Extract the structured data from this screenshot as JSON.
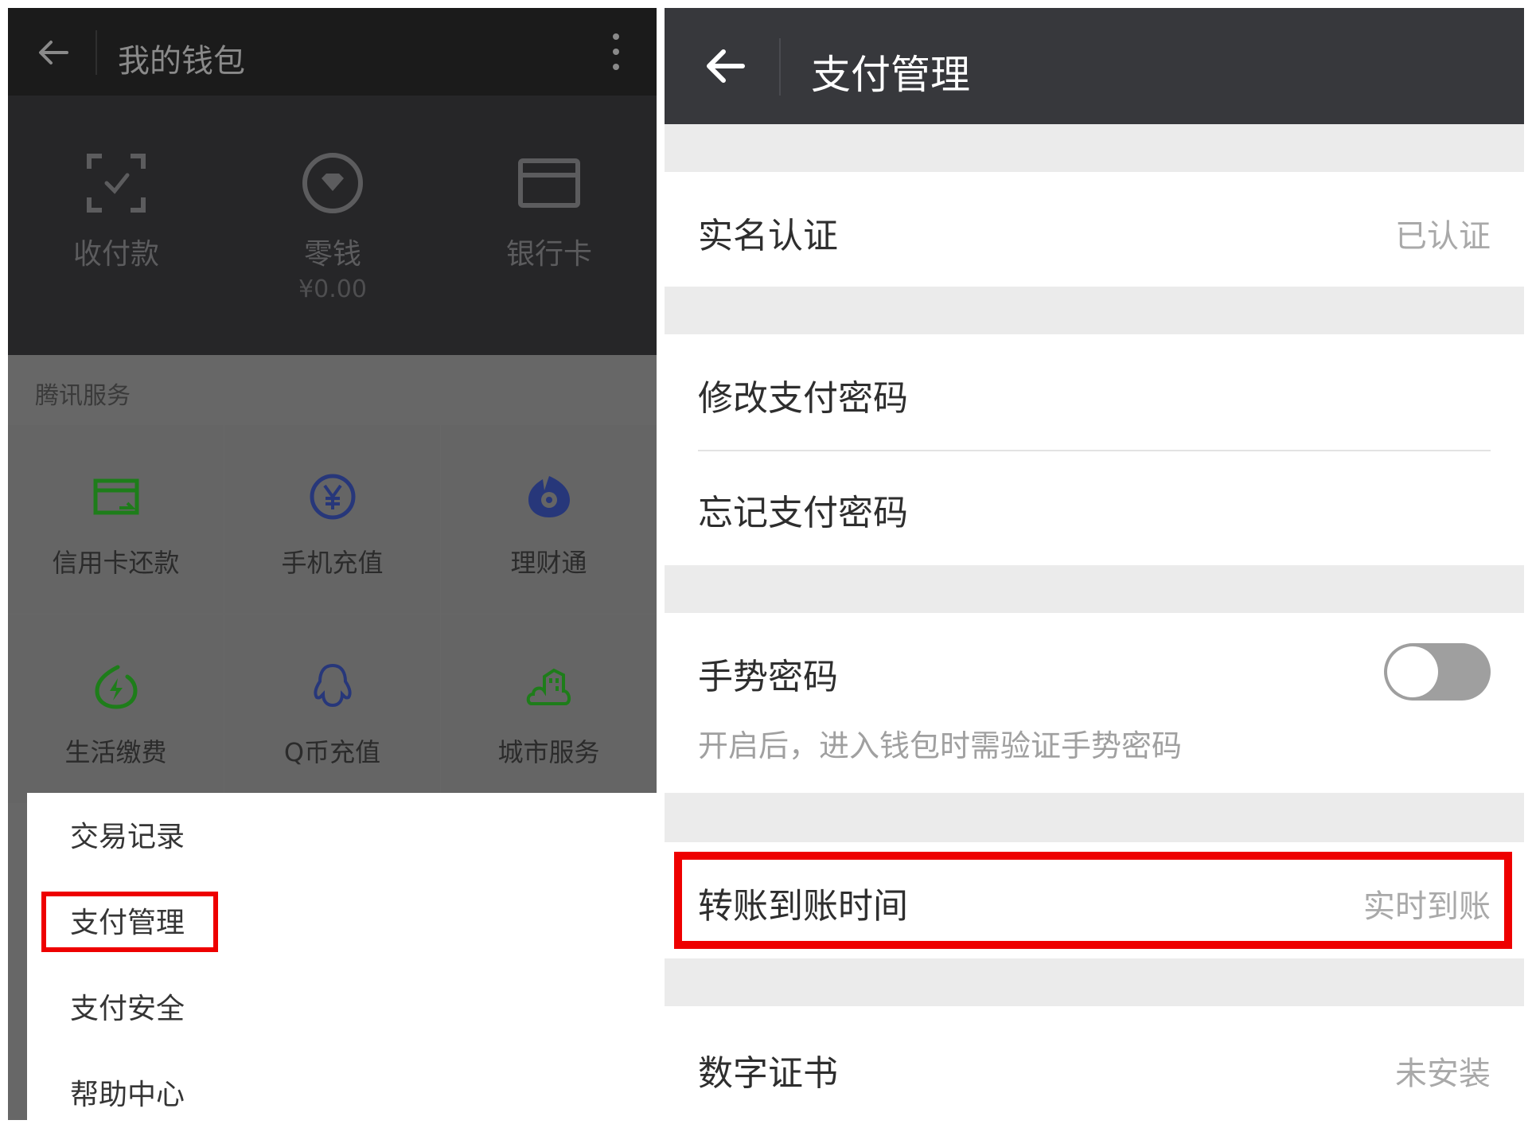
{
  "left": {
    "header": {
      "title": "我的钱包"
    },
    "top_items": [
      {
        "label": "收付款",
        "sub": ""
      },
      {
        "label": "零钱",
        "sub": "¥0.00"
      },
      {
        "label": "银行卡",
        "sub": ""
      }
    ],
    "section_title": "腾讯服务",
    "services": [
      {
        "label": "信用卡还款",
        "icon": "credit-card-repay-icon",
        "color": "#1e7d1a"
      },
      {
        "label": "手机充值",
        "icon": "yen-circle-icon",
        "color": "#27377a"
      },
      {
        "label": "理财通",
        "icon": "wealth-drop-icon",
        "color": "#27377a"
      },
      {
        "label": "生活缴费",
        "icon": "bolt-circle-icon",
        "color": "#1e7d1a"
      },
      {
        "label": "Q币充值",
        "icon": "penguin-icon",
        "color": "#27377a"
      },
      {
        "label": "城市服务",
        "icon": "city-icon",
        "color": "#1e7d1a"
      }
    ],
    "menu": [
      {
        "label": "交易记录"
      },
      {
        "label": "支付管理"
      },
      {
        "label": "支付安全"
      },
      {
        "label": "帮助中心"
      }
    ]
  },
  "right": {
    "header": {
      "title": "支付管理"
    },
    "rows": {
      "real_name": {
        "label": "实名认证",
        "value": "已认证"
      },
      "change_password": {
        "label": "修改支付密码"
      },
      "forgot_password": {
        "label": "忘记支付密码"
      },
      "gesture": {
        "label": "手势密码",
        "desc": "开启后，进入钱包时需验证手势密码",
        "enabled": false
      },
      "transfer_time": {
        "label": "转账到账时间",
        "value": "实时到账"
      },
      "certificate": {
        "label": "数字证书",
        "value": "未安装"
      }
    }
  },
  "colors": {
    "highlight": "#ee0000",
    "dark_header": "#37383c",
    "green_icon": "#1e7d1a",
    "blue_icon": "#27377a"
  }
}
